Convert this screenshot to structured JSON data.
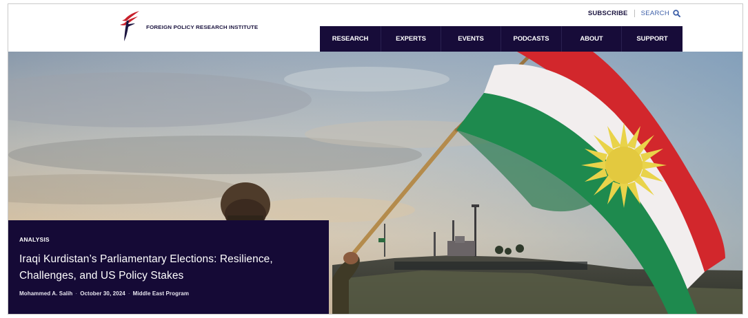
{
  "header": {
    "logo_text": "FOREIGN POLICY RESEARCH INSTITUTE",
    "utility": {
      "subscribe_label": "SUBSCRIBE",
      "search_label": "SEARCH",
      "search_icon": "search-icon"
    }
  },
  "nav": {
    "items": [
      {
        "label": "RESEARCH"
      },
      {
        "label": "EXPERTS"
      },
      {
        "label": "EVENTS"
      },
      {
        "label": "PODCASTS"
      },
      {
        "label": "ABOUT"
      },
      {
        "label": "SUPPORT"
      }
    ]
  },
  "feature": {
    "kicker": "ANALYSIS",
    "headline": "Iraqi Kurdistan’s Parliamentary Elections: Resilience, Challenges, and US Policy Stakes",
    "author": "Mohammed A. Salih",
    "date": "October 30, 2024",
    "program": "Middle East Program"
  },
  "colors": {
    "navy": "#170c39",
    "caption_bg": "#150a36",
    "search_blue": "#3d5fa8",
    "flag_red": "#d2272c",
    "flag_white": "#f2eeee",
    "flag_green": "#1e8a4e",
    "sun_yellow": "#e9d34a"
  }
}
